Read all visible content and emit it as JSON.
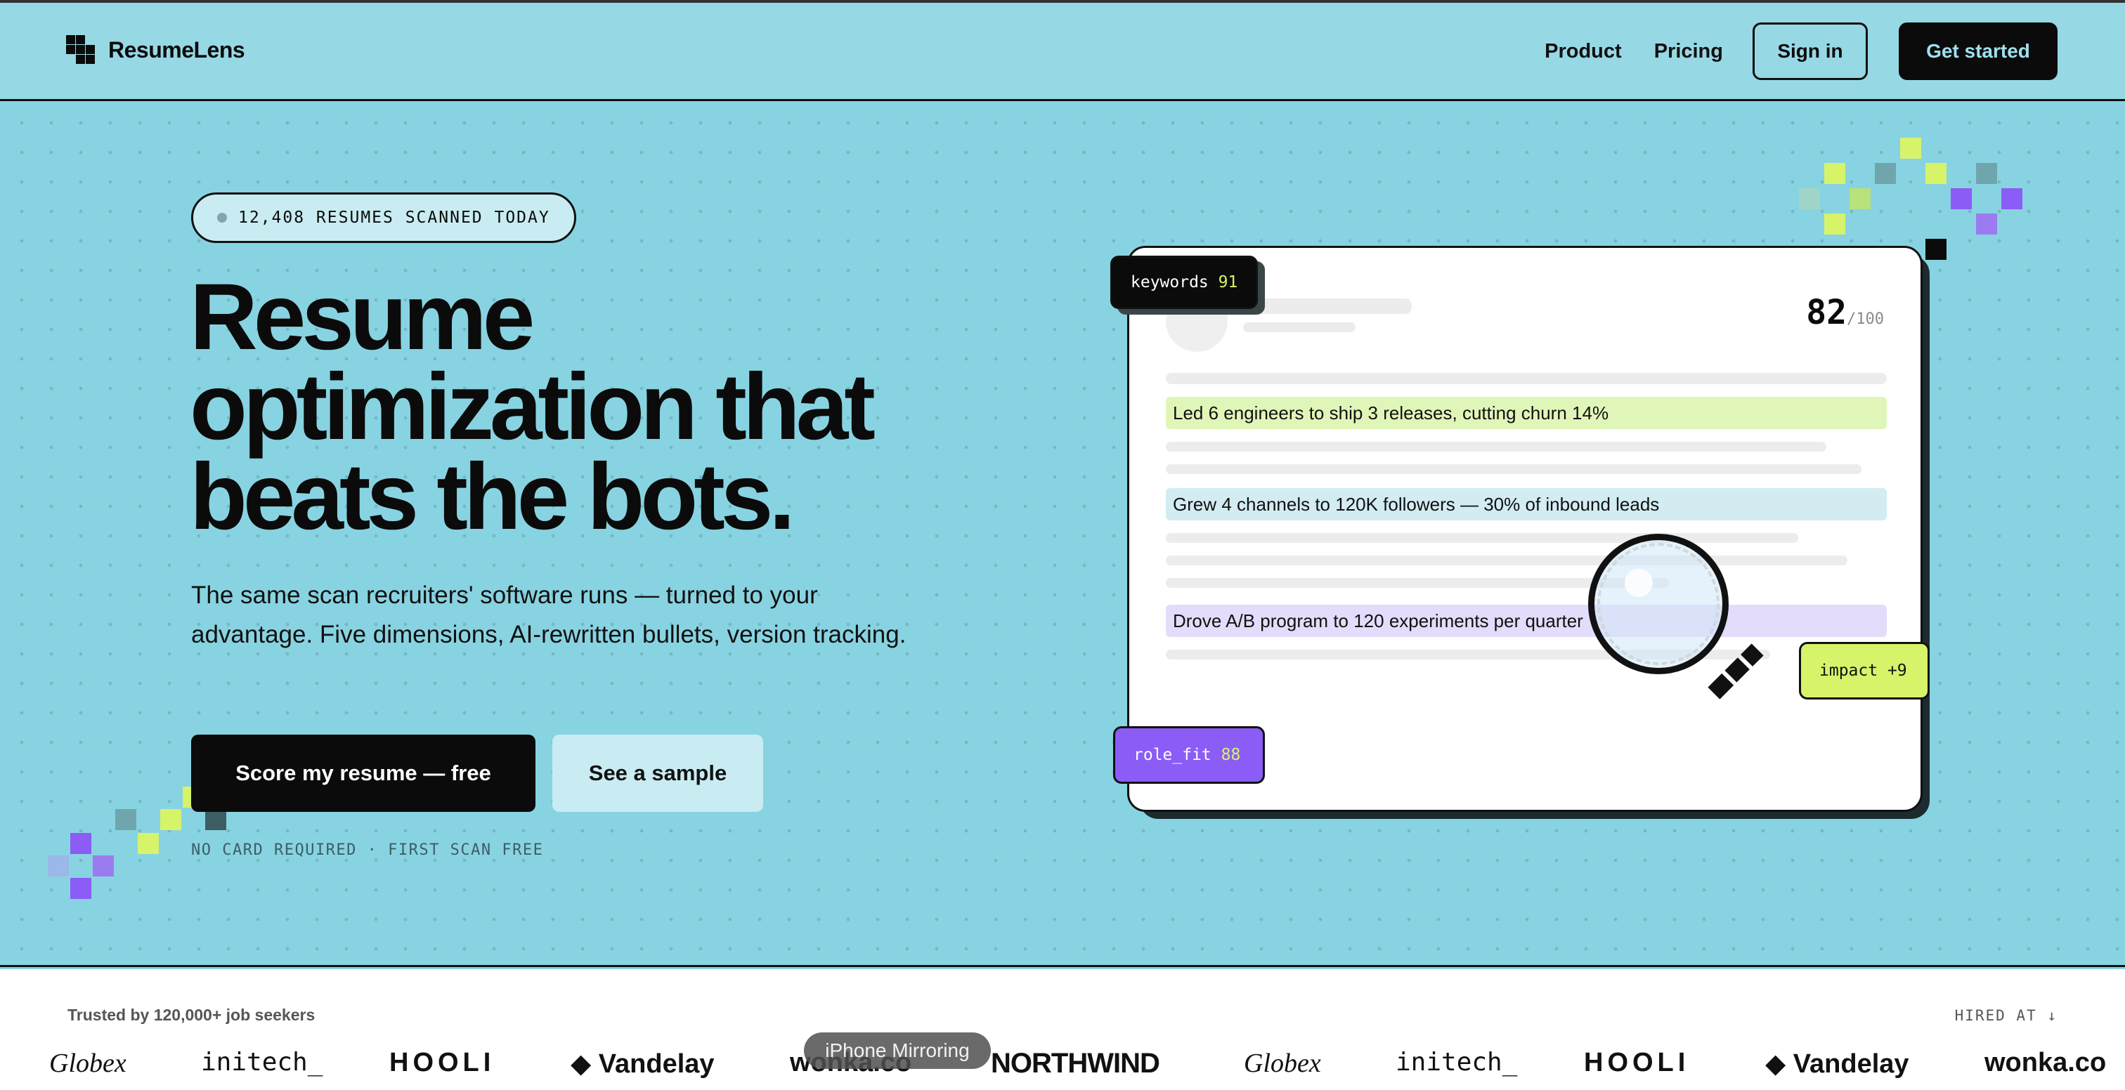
{
  "nav": {
    "brand": "ResumeLens",
    "links": [
      "Product",
      "Pricing"
    ],
    "signin_label": "Sign in",
    "getstarted_label": "Get started"
  },
  "hero": {
    "pill_text": "12,408 RESUMES SCANNED TODAY",
    "headline_lines": [
      "Resume",
      "optimization that",
      "beats the bots."
    ],
    "subtext": "The same scan recruiters' software runs — turned to your advantage. Five dimensions, AI-rewritten bullets, version tracking.",
    "primary_cta": "Score my resume — free",
    "secondary_cta": "See a sample",
    "note": "NO CARD REQUIRED · FIRST SCAN FREE"
  },
  "card": {
    "score": "82",
    "score_suffix": "/100",
    "bullets": [
      "Led 6 engineers to ship 3 releases, cutting churn 14%",
      "Grew 4 channels to 120K followers — 30% of inbound leads",
      "Drove A/B program to 120 experiments per quarter"
    ],
    "tags": {
      "keywords": {
        "label": "keywords",
        "value": "91"
      },
      "impact": {
        "label": "impact",
        "value": "+9"
      },
      "role_fit": {
        "label": "role_fit",
        "value": "88"
      }
    }
  },
  "trust": {
    "label": "Trusted by 120,000+ job seekers",
    "hired_at": "HIRED AT ↓",
    "brands": [
      "Globex",
      "initech_",
      "HOOLI",
      "◆ Vandelay",
      "wonka.co",
      "NORTHWIND",
      "Globex",
      "initech_",
      "HOOLI",
      "◆ Vandelay",
      "wonka.co"
    ]
  },
  "overlay": {
    "label": "iPhone Mirroring"
  },
  "colors": {
    "background": "#88d3e1",
    "nav": "#97d8e5",
    "accent_lime": "#d6f36a",
    "accent_purple": "#8b5cf6",
    "accent_teal": "#c9ecf2",
    "ink": "#0b0b0b"
  },
  "icons": {
    "logo": "pixel-grid-icon",
    "status": "status-dot-icon",
    "magnifier": "magnifying-glass-icon"
  }
}
